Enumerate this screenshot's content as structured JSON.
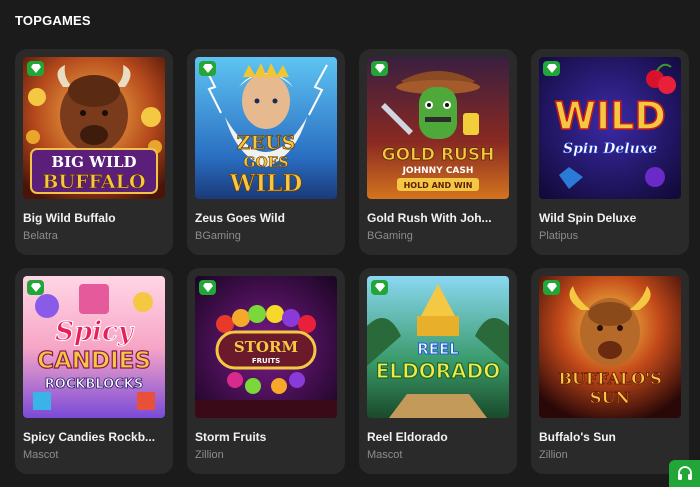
{
  "section": {
    "title": "TOPGAMES"
  },
  "games": [
    {
      "name": "Big Wild Buffalo",
      "provider": "Belatra",
      "art": [
        "BIG WILD",
        "BUFFALO"
      ],
      "badge": "diamond-badge-icon"
    },
    {
      "name": "Zeus Goes Wild",
      "provider": "BGaming",
      "art": [
        "ZEUS",
        "GOES",
        "WILD"
      ],
      "badge": "diamond-badge-icon"
    },
    {
      "name": "Gold Rush With Joh...",
      "provider": "BGaming",
      "art": [
        "GOLD RUSH",
        "JOHNNY CASH",
        "HOLD AND WIN"
      ],
      "badge": "diamond-badge-icon"
    },
    {
      "name": "Wild Spin Deluxe",
      "provider": "Platipus",
      "art": [
        "WILD",
        "Spin Deluxe"
      ],
      "badge": "diamond-badge-icon"
    },
    {
      "name": "Spicy Candies Rockb...",
      "provider": "Mascot",
      "art": [
        "Spicy",
        "CANDIES",
        "ROCKBLOCKS"
      ],
      "badge": "diamond-badge-icon"
    },
    {
      "name": "Storm Fruits",
      "provider": "Zillion",
      "art": [
        "STORM",
        "FRUITS"
      ],
      "badge": "diamond-badge-icon"
    },
    {
      "name": "Reel Eldorado",
      "provider": "Mascot",
      "art": [
        "REEL",
        "ELDORADO"
      ],
      "badge": "diamond-badge-icon"
    },
    {
      "name": "Buffalo's Sun",
      "provider": "Zillion",
      "art": [
        "BUFFALO'S",
        "SUN"
      ],
      "badge": "diamond-badge-icon"
    }
  ],
  "support": {
    "icon": "headset-icon"
  },
  "colors": {
    "background": "#1b1b1b",
    "card": "#2a2a2a",
    "accent": "#21a637",
    "provider_text": "#8c8c8c"
  }
}
